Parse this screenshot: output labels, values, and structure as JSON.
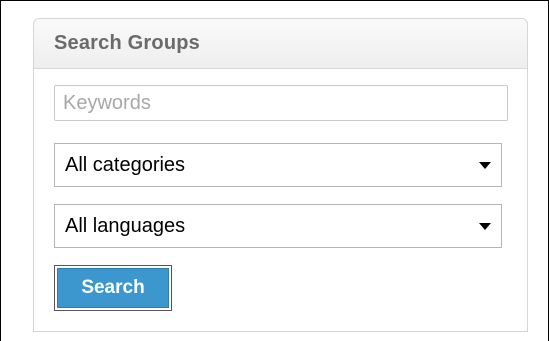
{
  "widget": {
    "title": "Search Groups",
    "keywords": {
      "value": "",
      "placeholder": "Keywords"
    },
    "category_select": {
      "selected": "All categories"
    },
    "language_select": {
      "selected": "All languages"
    },
    "search_button_label": "Search"
  },
  "colors": {
    "button_blue": "#3d97cf",
    "title_gray": "#6a6a6a",
    "placeholder_gray": "#a8a8a8"
  },
  "icons": {
    "dropdown": "chevron-down-icon"
  }
}
